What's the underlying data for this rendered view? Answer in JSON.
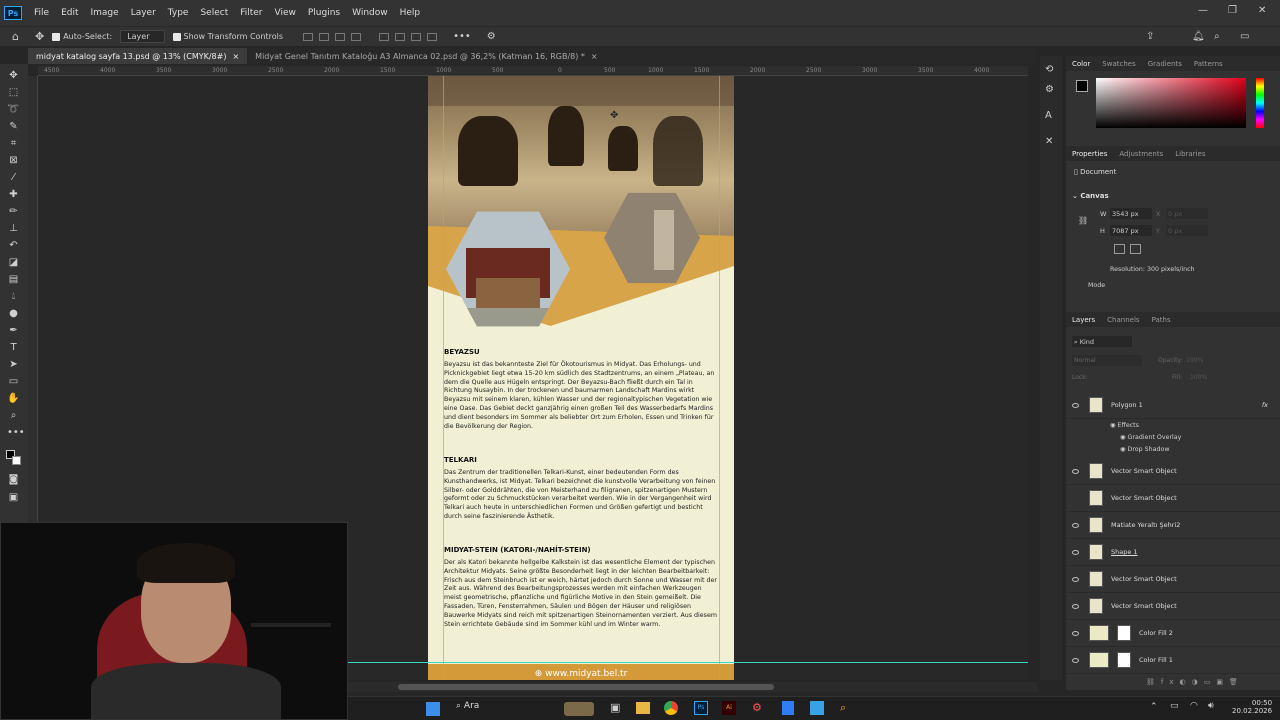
{
  "menubar": {
    "logo": "Ps",
    "items": [
      "File",
      "Edit",
      "Image",
      "Layer",
      "Type",
      "Select",
      "Filter",
      "View",
      "Plugins",
      "Window",
      "Help"
    ]
  },
  "options": {
    "auto_select_label": "Auto-Select:",
    "auto_select_value": "Layer",
    "transform_label": "Show Transform Controls"
  },
  "tabs": [
    {
      "label": "midyat katalog sayfa 13.psd @ 13% (CMYK/8#)",
      "active": true
    },
    {
      "label": "Midyat Genel Tanıtım Kataloğu A3 Almanca 02.psd @ 36,2% (Katman 16, RGB/8) *",
      "active": false
    }
  ],
  "document": {
    "s1_title": "BEYAZSU",
    "s1_text": "Beyazsu ist das bekannteste Ziel für Ökotourismus in Midyat. Das Erholungs- und Picknickgebiet liegt etwa 15-20 km südlich des Stadtzentrums, an einem „Plateau, an dem die Quelle aus Hügeln entspringt. Der Beyazsu-Bach fließt durch ein Tal in Richtung Nusaybin. In der trockenen und baumarmen Landschaft Mardins wirkt Beyazsu mit seinem klaren, kühlen Wasser und der regionaltypischen Vegetation wie eine Oase. Das Gebiet deckt ganzjährig einen großen Teil des Wasserbedarfs Mardins und dient besonders im Sommer als beliebter Ort zum Erholen, Essen und Trinken für die Bevölkerung der Region.",
    "s2_title": "TELKARI",
    "s2_text": "Das Zentrum der traditionellen Telkari-Kunst, einer bedeutenden Form des Kunsthandwerks, ist Midyat. Telkari bezeichnet die kunstvolle Verarbeitung von feinen Silber- oder Golddrähten, die von Meisterhand zu filigranen, spitzenartigen Mustern geformt oder zu Schmuckstücken verarbeitet werden. Wie in der Vergangenheit wird Telkari auch heute in unterschiedlichen Formen und Größen gefertigt und besticht durch seine faszinierende Ästhetik.",
    "s3_title": "MIDYAT-STEIN (KATORI-/NAHİT-STEIN)",
    "s3_text": "Der als Katori bekannte hellgelbe Kalkstein ist das wesentliche Element der typischen Architektur Midyats. Seine größte Besonderheit liegt in der leichten Bearbeitbarkeit: Frisch aus dem Steinbruch ist er weich, härtet jedoch durch Sonne und Wasser mit der Zeit aus. Während des Bearbeitungsprozesses werden mit einfachen Werkzeugen meist geometrische, pflanzliche und figürliche Motive in den Stein gemeißelt. Die Fassaden, Türen, Fensterrahmen, Säulen und Bögen der Häuser und religiösen Bauwerke Midyats sind reich mit spitzenartigen Steinornamenten verziert. Aus diesem Stein errichtete Gebäude sind im Sommer kühl und im Winter warm.",
    "footer": "www.midyat.bel.tr"
  },
  "ruler": [
    "4500",
    "4000",
    "3500",
    "3000",
    "2500",
    "2000",
    "1500",
    "1000",
    "500",
    "0",
    "500",
    "1000",
    "1500",
    "2000",
    "2500",
    "3000",
    "3500",
    "4000"
  ],
  "color_panel": {
    "tabs": [
      "Color",
      "Swatches",
      "Gradients",
      "Patterns"
    ]
  },
  "properties_panel": {
    "tabs": [
      "Properties",
      "Adjustments",
      "Libraries"
    ],
    "doc_label": "Document",
    "canvas_label": "Canvas",
    "w_label": "W",
    "w_value": "3543 px",
    "h_label": "H",
    "h_value": "7087 px",
    "x_label": "X",
    "y_label": "Y",
    "x_value": "0 px",
    "y_value": "0 px",
    "resolution": "Resolution: 300 pixels/inch",
    "mode": "Mode"
  },
  "layers_panel": {
    "tabs": [
      "Layers",
      "Channels",
      "Paths"
    ],
    "kind": "Kind",
    "blend": "Normal",
    "opacity_label": "Opacity:",
    "opacity_value": "100%",
    "lock_label": "Lock:",
    "fill_label": "Fill:",
    "fill_value": "100%",
    "rows": [
      {
        "name": "Polygon 1",
        "fx": "fx"
      },
      {
        "name": "Effects"
      },
      {
        "name": "Gradient Overlay"
      },
      {
        "name": "Drop Shadow"
      },
      {
        "name": "Vector Smart Object"
      },
      {
        "name": "Vector Smart Object"
      },
      {
        "name": "Matiate Yeraltı Şehri2"
      },
      {
        "name": "Shape 1"
      },
      {
        "name": "Vector Smart Object"
      },
      {
        "name": "Vector Smart Object"
      },
      {
        "name": "Color Fill 2"
      },
      {
        "name": "Color Fill 1"
      }
    ]
  },
  "taskbar": {
    "search": "Ara",
    "time": "00:50",
    "date": "20.02.2026"
  },
  "colors": {
    "accent": "#31a8ff",
    "doc_bg": "#f1f0d4",
    "gold": "#d8a44a",
    "guide": "#3ad6c2"
  }
}
